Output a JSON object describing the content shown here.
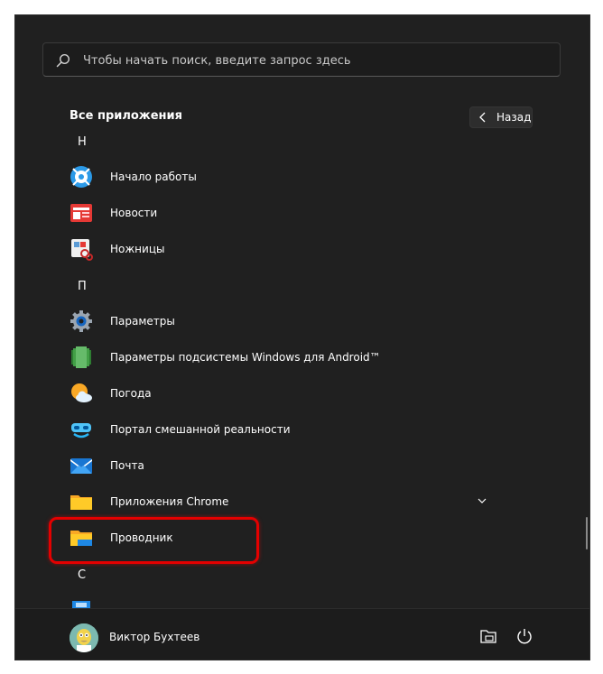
{
  "search": {
    "placeholder": "Чтобы начать поиск, введите запрос здесь"
  },
  "header": {
    "title": "Все приложения",
    "back_label": "Назад"
  },
  "sections": {
    "n_letter": "Н",
    "p_letter": "П",
    "s_letter": "С"
  },
  "apps": [
    {
      "label": "Начало работы",
      "icon": "tips-icon"
    },
    {
      "label": "Новости",
      "icon": "news-icon"
    },
    {
      "label": "Ножницы",
      "icon": "snipping-tool-icon"
    },
    {
      "label": "Параметры",
      "icon": "settings-gear-icon"
    },
    {
      "label": "Параметры подсистемы Windows для Android™",
      "icon": "android-subsystem-icon"
    },
    {
      "label": "Погода",
      "icon": "weather-icon"
    },
    {
      "label": "Портал смешанной реальности",
      "icon": "mixed-reality-icon"
    },
    {
      "label": "Почта",
      "icon": "mail-icon"
    },
    {
      "label": "Приложения Chrome",
      "icon": "folder-icon"
    },
    {
      "label": "Проводник",
      "icon": "file-explorer-icon"
    }
  ],
  "footer": {
    "user_name": "Виктор Бухтеев"
  },
  "colors": {
    "background": "#202020",
    "highlight": "#e40000",
    "footer": "#1c1c1c"
  }
}
